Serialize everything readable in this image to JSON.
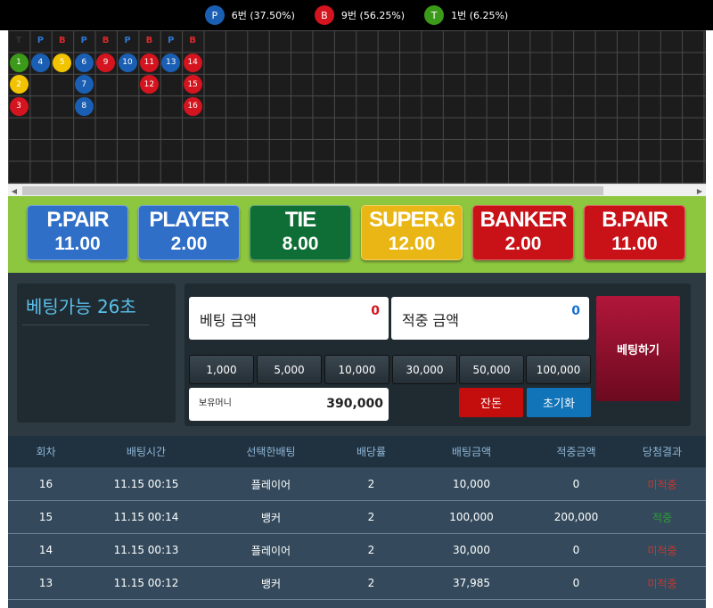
{
  "summary": [
    {
      "letter": "P",
      "text": "6번 (37.50%)",
      "color": "#1a5fb4"
    },
    {
      "letter": "B",
      "text": "9번 (56.25%)",
      "color": "#d4141e"
    },
    {
      "letter": "T",
      "text": "1번 (6.25%)",
      "color": "#3c9a1a"
    }
  ],
  "roadmap": {
    "header": [
      {
        "letter": "T",
        "color": "#333333"
      },
      {
        "letter": "P",
        "color": "#2f76d2"
      },
      {
        "letter": "B",
        "color": "#d92b2b"
      },
      {
        "letter": "P",
        "color": "#2f76d2"
      },
      {
        "letter": "B",
        "color": "#d92b2b"
      },
      {
        "letter": "P",
        "color": "#2f76d2"
      },
      {
        "letter": "B",
        "color": "#d92b2b"
      },
      {
        "letter": "P",
        "color": "#2f76d2"
      },
      {
        "letter": "B",
        "color": "#d92b2b"
      }
    ],
    "beads": [
      {
        "n": "1",
        "col": 0,
        "row": 0,
        "type": "T"
      },
      {
        "n": "2",
        "col": 0,
        "row": 1,
        "type": "Y"
      },
      {
        "n": "3",
        "col": 0,
        "row": 2,
        "type": "B"
      },
      {
        "n": "4",
        "col": 1,
        "row": 0,
        "type": "P"
      },
      {
        "n": "5",
        "col": 2,
        "row": 0,
        "type": "Y"
      },
      {
        "n": "6",
        "col": 3,
        "row": 0,
        "type": "P"
      },
      {
        "n": "7",
        "col": 3,
        "row": 1,
        "type": "P"
      },
      {
        "n": "8",
        "col": 3,
        "row": 2,
        "type": "P"
      },
      {
        "n": "9",
        "col": 4,
        "row": 0,
        "type": "B"
      },
      {
        "n": "10",
        "col": 5,
        "row": 0,
        "type": "P"
      },
      {
        "n": "11",
        "col": 6,
        "row": 0,
        "type": "B"
      },
      {
        "n": "12",
        "col": 6,
        "row": 1,
        "type": "B"
      },
      {
        "n": "13",
        "col": 7,
        "row": 0,
        "type": "P"
      },
      {
        "n": "14",
        "col": 8,
        "row": 0,
        "type": "B"
      },
      {
        "n": "15",
        "col": 8,
        "row": 1,
        "type": "B"
      },
      {
        "n": "16",
        "col": 8,
        "row": 2,
        "type": "B"
      }
    ],
    "colors": {
      "P": "#1a5fb4",
      "B": "#d4141e",
      "T": "#3c9a1a",
      "Y": "#f2c400"
    }
  },
  "bets": [
    {
      "name": "P.PAIR",
      "odds": "11.00",
      "bg": "#2f6fc8"
    },
    {
      "name": "PLAYER",
      "odds": "2.00",
      "bg": "#2f6fc8"
    },
    {
      "name": "TIE",
      "odds": "8.00",
      "bg": "#0e6e35"
    },
    {
      "name": "SUPER.6",
      "odds": "12.00",
      "bg": "#e9b615"
    },
    {
      "name": "BANKER",
      "odds": "2.00",
      "bg": "#c81218"
    },
    {
      "name": "B.PAIR",
      "odds": "11.00",
      "bg": "#c81218"
    }
  ],
  "timer": "베팅가능 26초",
  "fields": {
    "bet_label": "베팅 금액",
    "bet_value": "0",
    "win_label": "적중 금액",
    "win_value": "0"
  },
  "chips": [
    "1,000",
    "5,000",
    "10,000",
    "30,000",
    "50,000",
    "100,000"
  ],
  "money": {
    "label": "보유머니",
    "value": "390,000"
  },
  "buttons": {
    "balance": "잔돈",
    "reset": "초기화",
    "place": "베팅하기"
  },
  "history": {
    "headers": [
      "회차",
      "배팅시간",
      "선택한배팅",
      "배당률",
      "배팅금액",
      "적중금액",
      "당첨결과"
    ],
    "rows": [
      {
        "round": "16",
        "time": "11.15 00:15",
        "choice": "플레이어",
        "odds": "2",
        "amount": "10,000",
        "win": "0",
        "result": "미적중",
        "result_color": "#c9362e"
      },
      {
        "round": "15",
        "time": "11.15 00:14",
        "choice": "뱅커",
        "odds": "2",
        "amount": "100,000",
        "win": "200,000",
        "result": "적중",
        "result_color": "#2e9c37"
      },
      {
        "round": "14",
        "time": "11.15 00:13",
        "choice": "플레이어",
        "odds": "2",
        "amount": "30,000",
        "win": "0",
        "result": "미적중",
        "result_color": "#c9362e"
      },
      {
        "round": "13",
        "time": "11.15 00:12",
        "choice": "뱅커",
        "odds": "2",
        "amount": "37,985",
        "win": "0",
        "result": "미적중",
        "result_color": "#c9362e"
      }
    ]
  }
}
